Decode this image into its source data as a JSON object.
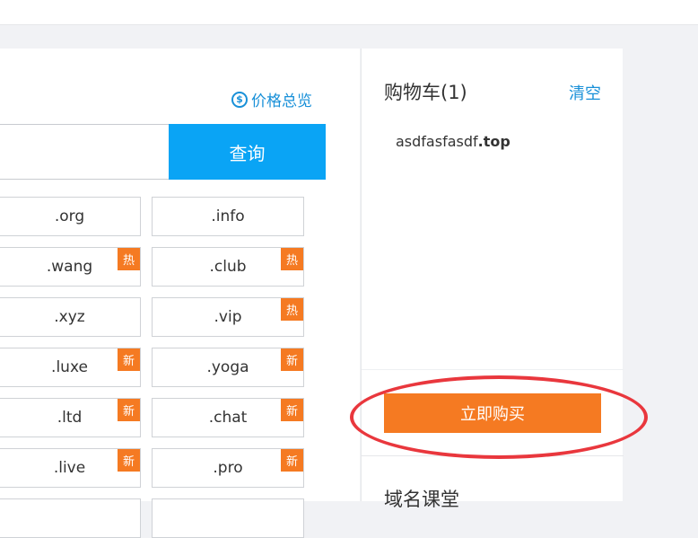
{
  "search": {
    "price_overview_label": "价格总览",
    "price_icon_glyph": "$",
    "button_label": "查询",
    "input_value": ""
  },
  "tlds": [
    {
      "name": ".org",
      "badge": ""
    },
    {
      "name": ".info",
      "badge": ""
    },
    {
      "name": ".wang",
      "badge": "热"
    },
    {
      "name": ".club",
      "badge": "热"
    },
    {
      "name": ".xyz",
      "badge": ""
    },
    {
      "name": ".vip",
      "badge": "热"
    },
    {
      "name": ".luxe",
      "badge": "新"
    },
    {
      "name": ".yoga",
      "badge": "新"
    },
    {
      "name": ".ltd",
      "badge": "新"
    },
    {
      "name": ".chat",
      "badge": "新"
    },
    {
      "name": ".live",
      "badge": "新"
    },
    {
      "name": ".pro",
      "badge": "新"
    }
  ],
  "cart": {
    "title": "购物车(1)",
    "clear_label": "清空",
    "item_name": "asdfasfasdf",
    "item_suffix": ".top",
    "buy_label": "立即购买"
  },
  "course": {
    "title": "域名课堂"
  },
  "colors": {
    "accent_blue": "#0aa4f5",
    "link_blue": "#1890d8",
    "orange": "#f57a22",
    "annotation_red": "#e9373d"
  }
}
